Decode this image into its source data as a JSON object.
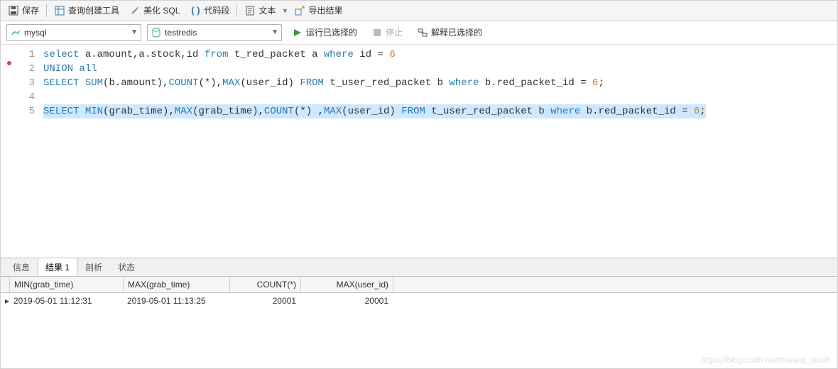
{
  "toolbar": {
    "save": "保存",
    "query_builder": "查询创建工具",
    "beautify": "美化 SQL",
    "snippet": "代码段",
    "text": "文本",
    "export": "导出结果"
  },
  "selectors": {
    "connection": "mysql",
    "database": "testredis",
    "run": "运行已选择的",
    "stop": "停止",
    "explain": "解释已选择的"
  },
  "sql": {
    "lines": [
      {
        "n": 1,
        "t": "select a.amount,a.stock,id from t_red_packet a where id = 6"
      },
      {
        "n": 2,
        "t": "UNION all"
      },
      {
        "n": 3,
        "t": "SELECT SUM(b.amount),COUNT(*),MAX(user_id) FROM t_user_red_packet b where b.red_packet_id = 6;"
      },
      {
        "n": 4,
        "t": ""
      },
      {
        "n": 5,
        "t": "SELECT MIN(grab_time),MAX(grab_time),COUNT(*) ,MAX(user_id) FROM t_user_red_packet b where b.red_packet_id = 6;",
        "hl": true
      }
    ]
  },
  "tabs": {
    "info": "信息",
    "result": "结果 1",
    "profile": "剖析",
    "status": "状态"
  },
  "grid": {
    "headers": [
      "MIN(grab_time)",
      "MAX(grab_time)",
      "COUNT(*)",
      "MAX(user_id)"
    ],
    "rows": [
      [
        "2019-05-01 11:12:31",
        "2019-05-01 11:13:25",
        "20001",
        "20001"
      ]
    ]
  },
  "watermark": "https://blog.csdn.net/toward_south"
}
